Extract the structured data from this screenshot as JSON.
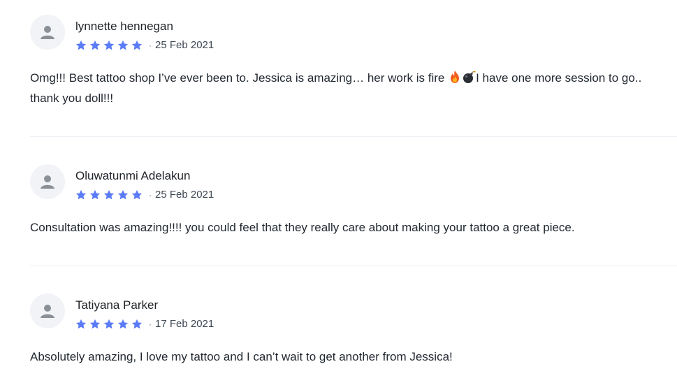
{
  "reviews": [
    {
      "name": "lynnette hennegan",
      "rating": 5,
      "separator": "·",
      "date": "25 Feb 2021",
      "text_before_icons": "Omg!!! Best tattoo shop I’ve ever been to. Jessica is amazing… her work is fire ",
      "icons": [
        "fire-icon",
        "bomb-icon"
      ],
      "text_after_icons": "I have one more session to go.. thank you doll!!!"
    },
    {
      "name": "Oluwatunmi Adelakun",
      "rating": 5,
      "separator": "·",
      "date": "25 Feb 2021",
      "text": "Consultation was amazing!!!! you could feel that they really care about making your tattoo a great piece."
    },
    {
      "name": "Tatiyana Parker",
      "rating": 5,
      "separator": "·",
      "date": "17 Feb 2021",
      "text": "Absolutely amazing, I love my tattoo and I can’t wait to get another from Jessica!"
    }
  ],
  "colors": {
    "star": "#5b7cf6",
    "avatar_bg": "#f1f3f7",
    "avatar_icon": "#8b8f96",
    "divider": "#eceff3"
  }
}
